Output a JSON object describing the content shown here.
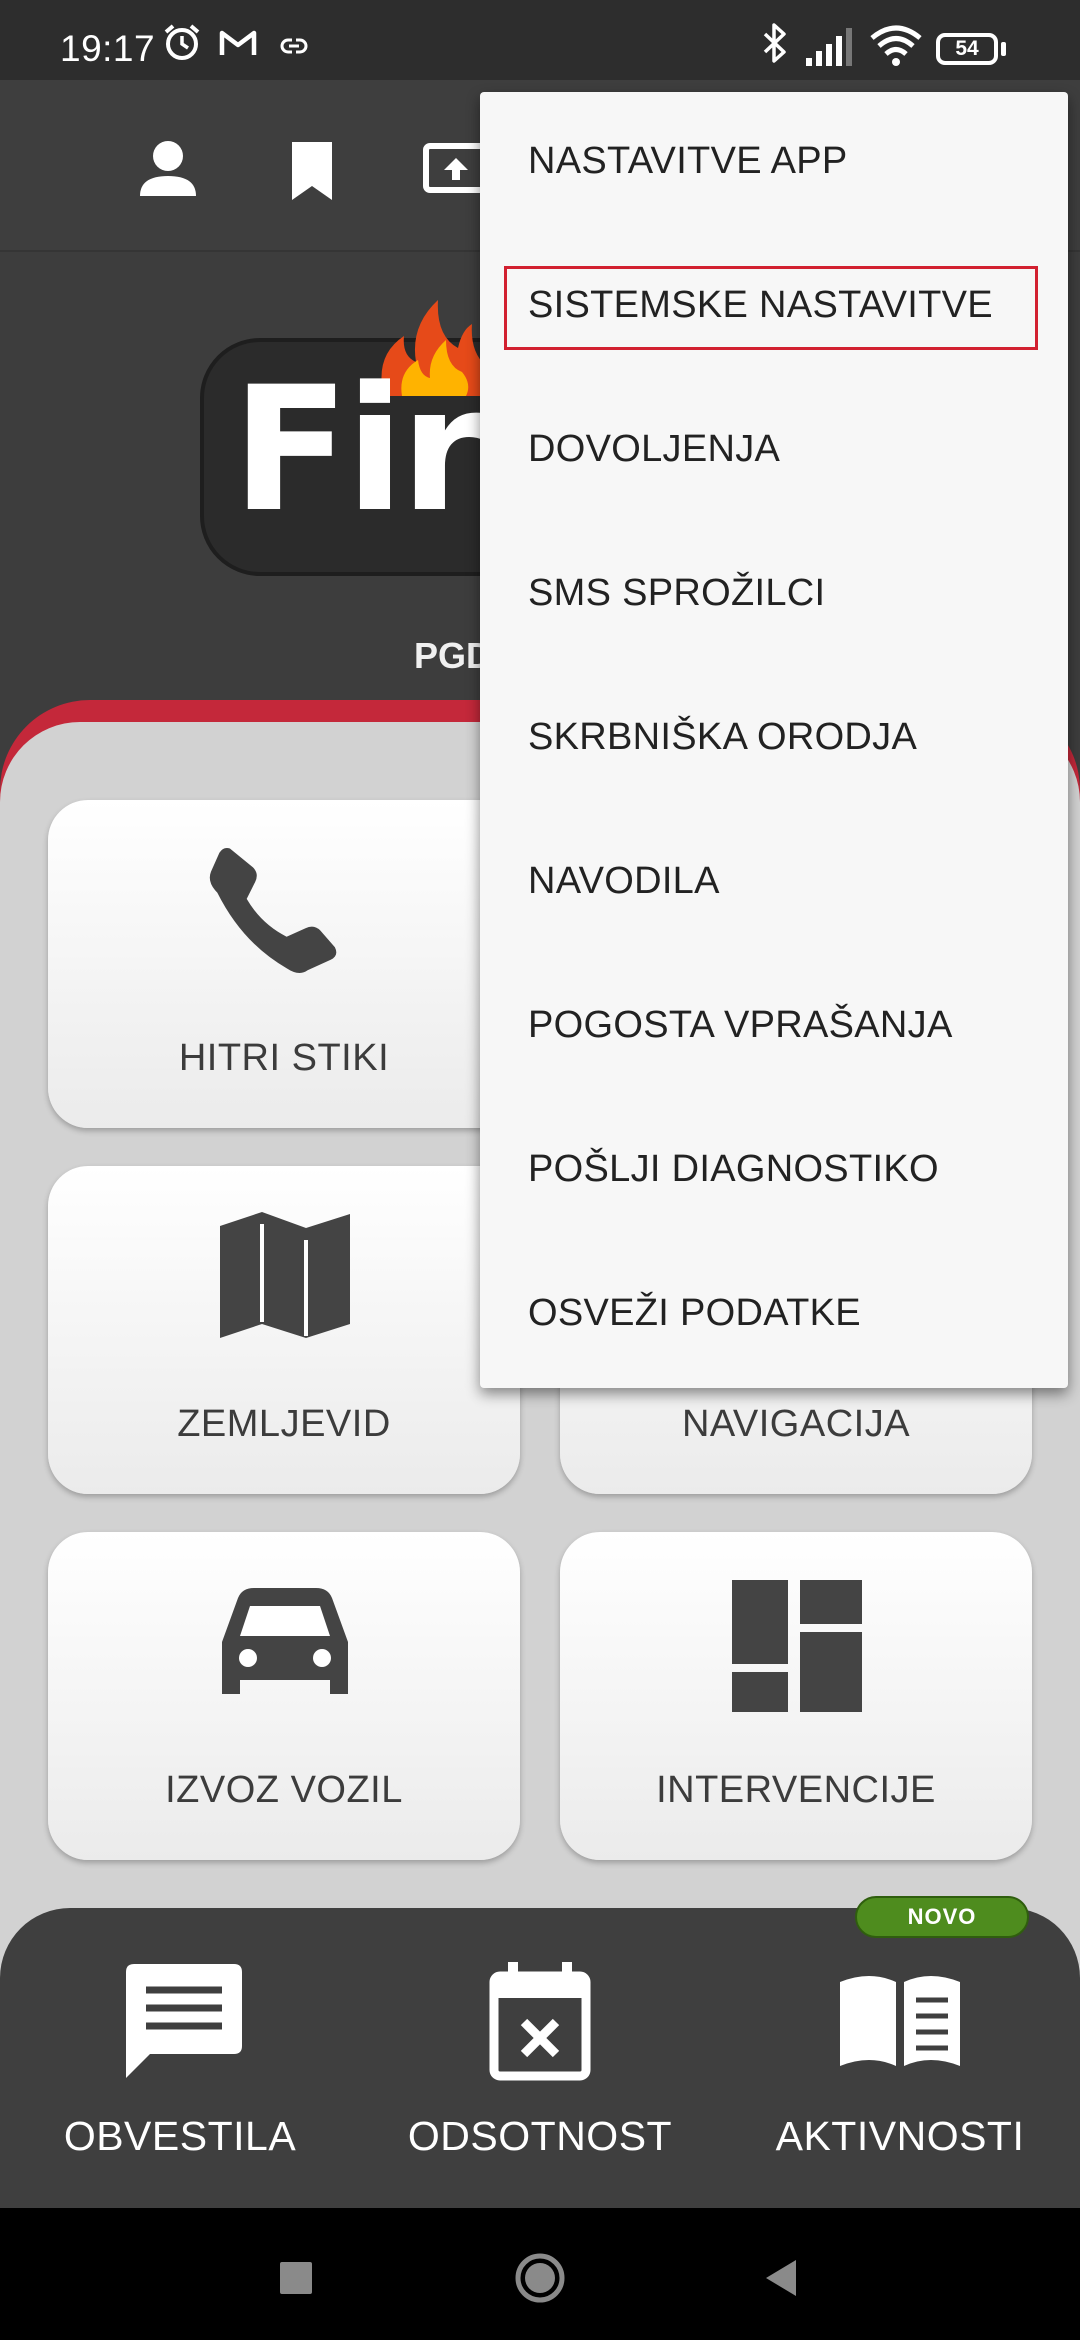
{
  "status_bar": {
    "time": "19:17",
    "battery": "54",
    "icons": [
      "alarm-icon",
      "gmail-icon",
      "link-icon",
      "bluetooth-icon",
      "signal-icon",
      "wifi-icon",
      "battery-icon"
    ]
  },
  "app_bar": {
    "icons": [
      "person-icon",
      "bookmark-icon",
      "screen-share-icon"
    ]
  },
  "header": {
    "logo_text": "Fire",
    "org_name": "PGD"
  },
  "tiles": [
    {
      "label": "HITRI STIKI",
      "icon": "phone-icon"
    },
    {
      "label": "ZEMLJEVID",
      "icon": "map-icon"
    },
    {
      "label": "NAVIGACIJA",
      "icon": "navigation-icon"
    },
    {
      "label": "IZVOZ VOZIL",
      "icon": "car-icon"
    },
    {
      "label": "INTERVENCIJE",
      "icon": "dashboard-icon"
    }
  ],
  "bottom_bar": {
    "items": [
      {
        "label": "OBVESTILA",
        "icon": "message-icon"
      },
      {
        "label": "ODSOTNOST",
        "icon": "calendar-cancel-icon"
      },
      {
        "label": "AKTIVNOSTI",
        "icon": "book-icon"
      }
    ],
    "badge": "NOVO"
  },
  "menu": {
    "items": [
      "NASTAVITVE APP",
      "SISTEMSKE NASTAVITVE",
      "DOVOLJENJA",
      "SMS SPROŽILCI",
      "SKRBNIŠKA ORODJA",
      "NAVODILA",
      "POGOSTA VPRAŠANJA",
      "POŠLJI DIAGNOSTIKO",
      "OSVEŽI PODATKE"
    ],
    "highlighted": "SISTEMSKE NASTAVITVE",
    "highlight_color": "#d22030"
  },
  "colors": {
    "accent_red": "#c4283a",
    "badge_green": "#4e8c1e",
    "dark_bg": "#3d3d3d"
  }
}
